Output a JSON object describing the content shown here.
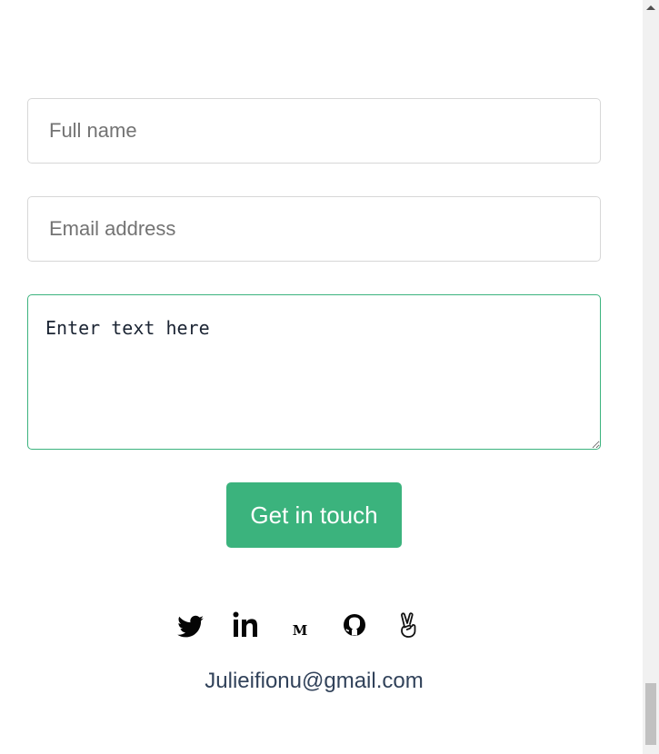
{
  "form": {
    "full_name_placeholder": "Full name",
    "email_placeholder": "Email address",
    "message_placeholder": "Enter text here",
    "submit_label": "Get in touch"
  },
  "social": {
    "icons": [
      "twitter-icon",
      "linkedin-icon",
      "medium-icon",
      "github-icon",
      "peace-hand-icon"
    ]
  },
  "contact": {
    "email": "Julieifionu@gmail.com"
  },
  "colors": {
    "accent": "#3bb37d",
    "text_dark": "#31425a",
    "border": "#d7d7d7"
  }
}
